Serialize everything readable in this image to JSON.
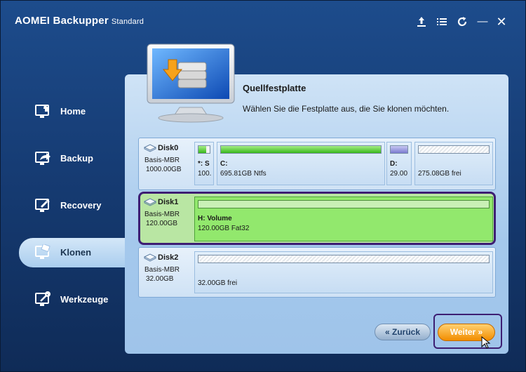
{
  "app": {
    "title": "AOMEI Backupper",
    "edition": "Standard"
  },
  "titlebar": {
    "icons": [
      "upload-icon",
      "menu-icon",
      "refresh-icon",
      "minimize-icon",
      "close-icon"
    ],
    "minimize_glyph": "—",
    "close_glyph": "✕"
  },
  "sidebar": {
    "items": [
      {
        "label": "Home",
        "icon": "home-icon"
      },
      {
        "label": "Backup",
        "icon": "backup-icon"
      },
      {
        "label": "Recovery",
        "icon": "recovery-icon"
      },
      {
        "label": "Klonen",
        "icon": "clone-icon",
        "active": true
      },
      {
        "label": "Werkzeuge",
        "icon": "tools-icon"
      }
    ]
  },
  "header": {
    "title": "Quellfestplatte",
    "description": "Wählen Sie die Festplatte aus, die Sie klonen möchten."
  },
  "disks": [
    {
      "name": "Disk0",
      "type": "Basis-MBR",
      "size": "1000.00GB",
      "partitions": [
        {
          "label": "*: S",
          "size": "100.",
          "used": 0.7
        },
        {
          "label": "C:",
          "size": "695.81GB Ntfs",
          "used": 1.0
        },
        {
          "label": "D:",
          "size": "29.00",
          "used": 1.0
        },
        {
          "label": "",
          "size": "275.08GB frei",
          "used": 0
        }
      ]
    },
    {
      "name": "Disk1",
      "type": "Basis-MBR",
      "size": "120.00GB",
      "selected": true,
      "partitions": [
        {
          "label": "H: Volume",
          "size": "120.00GB Fat32",
          "used": 0
        }
      ]
    },
    {
      "name": "Disk2",
      "type": "Basis-MBR",
      "size": "32.00GB",
      "partitions": [
        {
          "label": "",
          "size": "32.00GB frei",
          "used": 0
        }
      ]
    }
  ],
  "buttons": {
    "back": "« Zurück",
    "next": "Weiter »"
  },
  "colors": {
    "accent_orange": "#f28d00",
    "selection_outline": "#3d1e73",
    "used_green": "#37b81b"
  }
}
